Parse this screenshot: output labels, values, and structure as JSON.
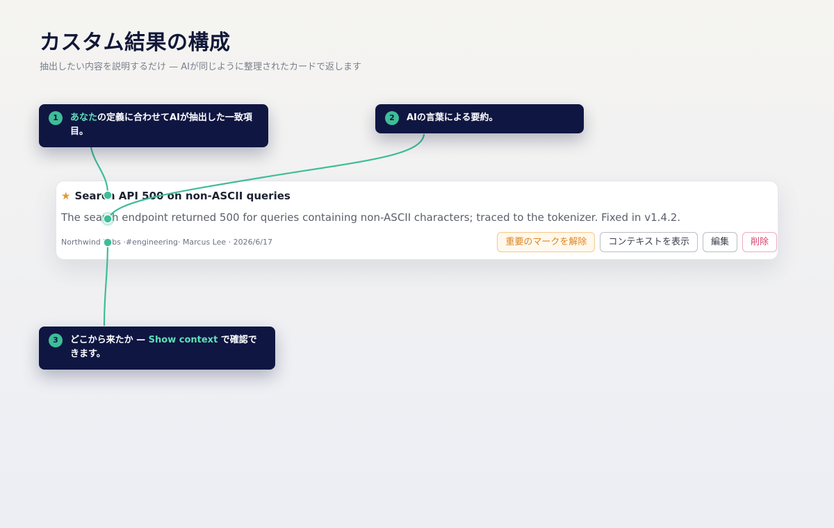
{
  "header": {
    "title": "カスタム結果の構成",
    "subtitle": "抽出したい内容を説明するだけ — AIが同じように整理されたカードで返します"
  },
  "callouts": [
    {
      "number": "1",
      "highlight": "あなた",
      "text": "の定義に合わせてAIが抽出した一致項目。",
      "highlight_after": "",
      "text_after": ""
    },
    {
      "number": "2",
      "highlight": "",
      "text": "AIの言葉による要約。",
      "highlight_after": "",
      "text_after": ""
    },
    {
      "number": "3",
      "highlight": "",
      "text": "どこから来たか — ",
      "highlight_after": "Show context",
      "text_after": " で確認できます。"
    }
  ],
  "card": {
    "star_icon": "★",
    "title": "Search API 500 on non-ASCII queries",
    "summary": "The search endpoint returned 500 for queries containing non-ASCII characters; traced to the tokenizer. Fixed in v1.4.2.",
    "meta": {
      "source": "Northwind Labs",
      "channel": "#engineering",
      "author": "Marcus Lee",
      "date": "2026/6/17"
    },
    "actions": {
      "unmark_label": "重要のマークを解除",
      "context_label": "コンテキストを表示",
      "edit_label": "編集",
      "delete_label": "削除"
    }
  },
  "colors": {
    "callout_bg": "#0f1642",
    "accent": "#3ebd98",
    "highlight_text": "#5fe0b8",
    "star": "#e8962e",
    "delete": "#d9456f"
  }
}
